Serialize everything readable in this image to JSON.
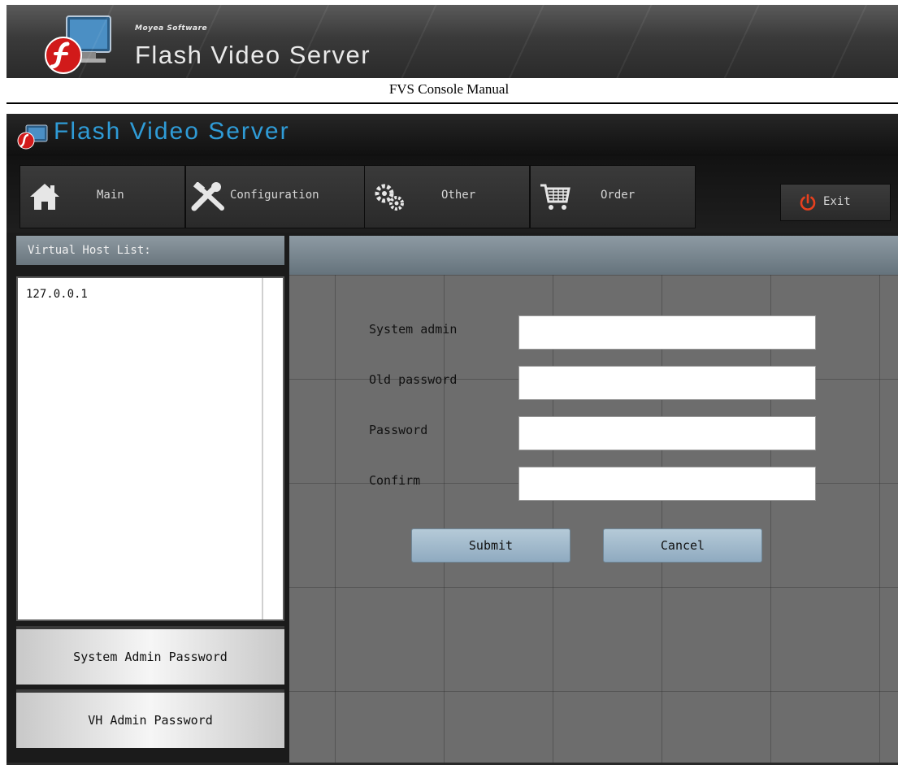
{
  "document": {
    "brand": "Moyea Software",
    "product": "Flash Video Server",
    "caption": "FVS Console Manual"
  },
  "app": {
    "title": "Flash Video Server",
    "title_color": "#2f9bd6"
  },
  "nav": {
    "main": "Main",
    "configuration": "Configuration",
    "other": "Other",
    "order": "Order",
    "exit": "Exit"
  },
  "sidebar": {
    "header": "Virtual Host List:",
    "hosts": [
      "127.0.0.1"
    ],
    "buttons": {
      "system_admin_password": "System Admin Password",
      "vh_admin_password": "VH Admin Password"
    }
  },
  "form": {
    "system_admin_label": "System admin",
    "old_password_label": "Old password",
    "password_label": "Password",
    "confirm_label": "Confirm",
    "system_admin_value": "",
    "old_password_value": "",
    "password_value": "",
    "confirm_value": "",
    "submit_label": "Submit",
    "cancel_label": "Cancel"
  },
  "icons": {
    "banner_logo": "flash-monitor-icon",
    "app_logo": "flash-monitor-icon",
    "main": "house-icon",
    "configuration": "tools-icon",
    "other": "gears-icon",
    "order": "shopping-cart-icon",
    "exit": "power-icon"
  }
}
